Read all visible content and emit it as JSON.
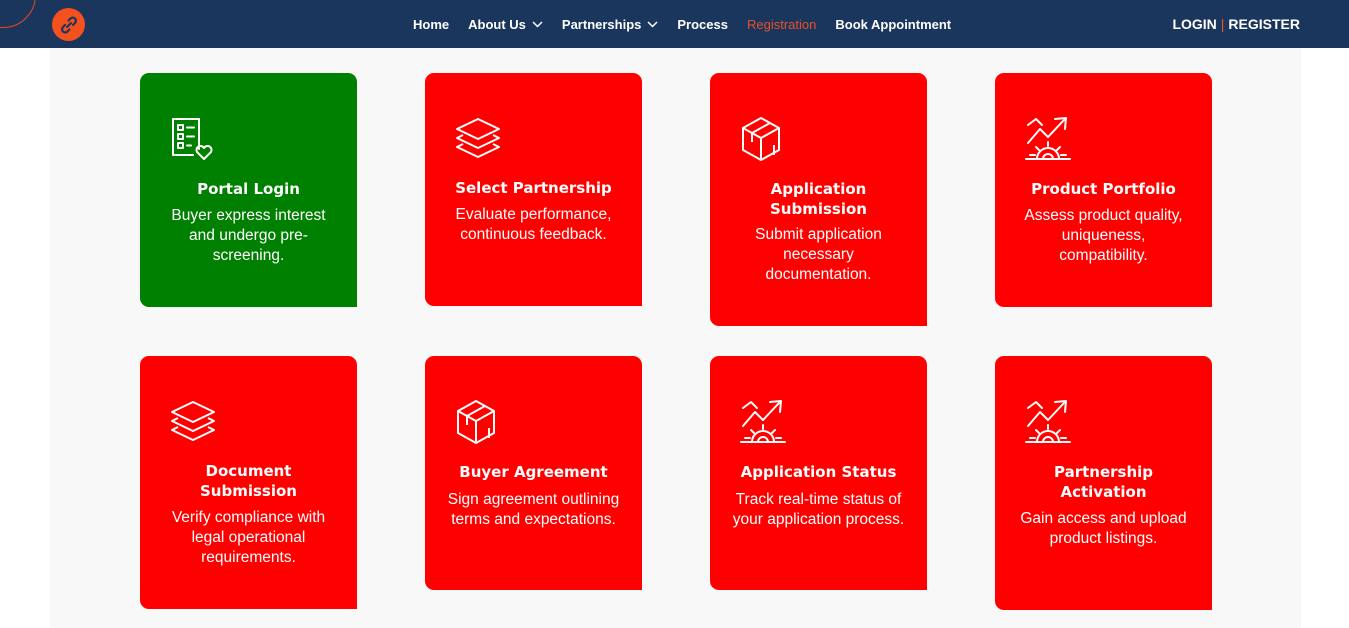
{
  "nav": {
    "items": [
      {
        "label": "Home",
        "has_dropdown": false,
        "active": false
      },
      {
        "label": "About Us",
        "has_dropdown": true,
        "active": false
      },
      {
        "label": "Partnerships",
        "has_dropdown": true,
        "active": false
      },
      {
        "label": "Process",
        "has_dropdown": false,
        "active": false
      },
      {
        "label": "Registration",
        "has_dropdown": false,
        "active": true
      },
      {
        "label": "Book Appointment",
        "has_dropdown": false,
        "active": false
      }
    ],
    "login_label": "LOGIN",
    "separator": "|",
    "register_label": "REGISTER",
    "logo_icon": "link-icon"
  },
  "colors": {
    "nav_bg": "#1b365d",
    "brand_orange": "#f4511e",
    "card_red": "#ff0000",
    "card_green": "#008000",
    "content_bg": "#f8f8f8"
  },
  "steps": [
    {
      "title": "Portal Login",
      "description": "Buyer express interest and undergo pre-screening.",
      "icon": "checklist-heart-icon",
      "color": "green"
    },
    {
      "title": "Select Partnership",
      "description": "Evaluate performance, continuous feedback.",
      "icon": "layers-icon",
      "color": "red"
    },
    {
      "title": "Application Submission",
      "description": "Submit application necessary documentation.",
      "icon": "box-icon",
      "color": "red"
    },
    {
      "title": "Product Portfolio",
      "description": "Assess product quality, uniqueness, compatibility.",
      "icon": "growth-gear-icon",
      "color": "red"
    },
    {
      "title": "Document Submission",
      "description": "Verify compliance with legal operational requirements.",
      "icon": "layers-icon",
      "color": "red"
    },
    {
      "title": "Buyer Agreement",
      "description": "Sign agreement outlining terms and expectations.",
      "icon": "box-icon",
      "color": "red"
    },
    {
      "title": "Application Status",
      "description": "Track real-time status of your application process.",
      "icon": "growth-gear-icon",
      "color": "red"
    },
    {
      "title": "Partnership Activation",
      "description": "Gain access and upload product listings.",
      "icon": "growth-gear-icon",
      "color": "red"
    }
  ]
}
